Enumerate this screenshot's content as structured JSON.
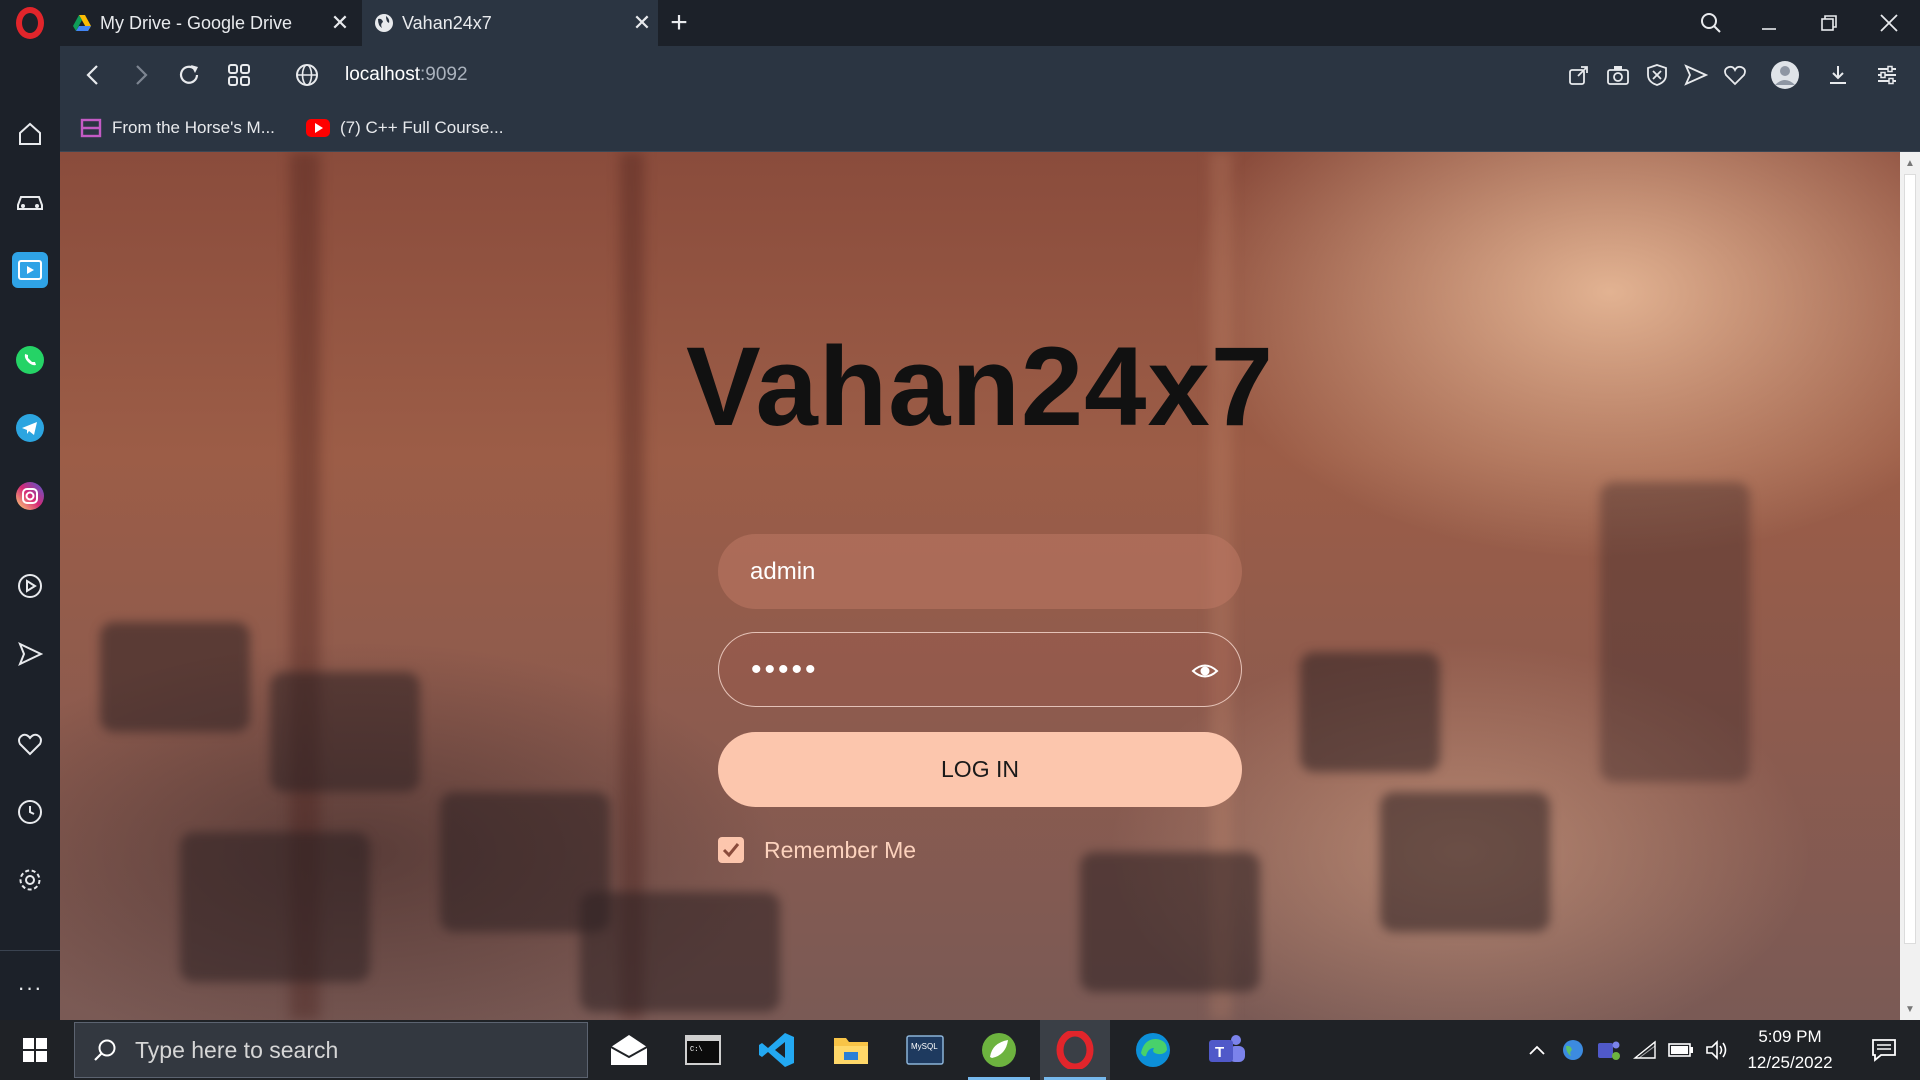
{
  "browser": {
    "tabs": [
      {
        "title": "My Drive - Google Drive",
        "active": false
      },
      {
        "title": "Vahan24x7",
        "active": true
      }
    ],
    "url_host": "localhost",
    "url_port": ":9092",
    "bookmarks": [
      {
        "label": "From the Horse's M..."
      },
      {
        "label": "(7) C++ Full Course..."
      }
    ],
    "sidebar_icons": [
      "home-icon",
      "car-icon",
      "player-icon",
      "whatsapp-icon",
      "telegram-icon",
      "instagram-icon",
      "play-circle-icon",
      "send-icon",
      "heart-icon",
      "history-icon",
      "settings-icon",
      "more-icon"
    ],
    "accent_color": "#e1252b"
  },
  "page": {
    "brand": "Vahan24x7",
    "username_value": "admin",
    "password_value": "•••••",
    "login_label": "LOG IN",
    "remember_label": "Remember Me",
    "remember_checked": true,
    "button_color": "#fcc6ad"
  },
  "taskbar": {
    "search_placeholder": "Type here to search",
    "time": "5:09 PM",
    "date": "12/25/2022",
    "apps": [
      "mail-icon",
      "terminal-icon",
      "vscode-icon",
      "file-explorer-icon",
      "mysql-icon",
      "spring-icon",
      "opera-icon",
      "edge-icon",
      "teams-icon"
    ]
  }
}
